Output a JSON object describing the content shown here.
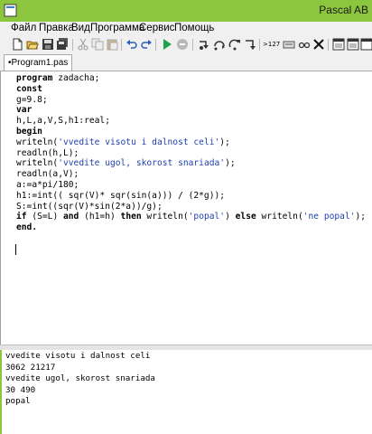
{
  "window": {
    "title": "Pascal AB"
  },
  "menu": [
    "Файл",
    "Правка",
    "Вид",
    "Программа",
    "Сервис",
    "Помощь"
  ],
  "toolbar": {
    "zoom_label": ">127"
  },
  "tabs": [
    {
      "label": "•Program1.pas"
    }
  ],
  "editor": {
    "lines": [
      [
        {
          "t": "program",
          "c": "kw"
        },
        {
          "t": " zadacha;",
          "c": ""
        }
      ],
      [
        {
          "t": "const",
          "c": "kw"
        }
      ],
      [
        {
          "t": "g=9.8;",
          "c": ""
        }
      ],
      [
        {
          "t": "var",
          "c": "kw"
        }
      ],
      [
        {
          "t": "h,L,a,V,S,h1:real;",
          "c": ""
        }
      ],
      [
        {
          "t": "begin",
          "c": "kw"
        }
      ],
      [
        {
          "t": "writeln(",
          "c": ""
        },
        {
          "t": "'vvedite visotu i dalnost celi'",
          "c": "str"
        },
        {
          "t": ");",
          "c": ""
        }
      ],
      [
        {
          "t": "readln(h,L);",
          "c": ""
        }
      ],
      [
        {
          "t": "writeln(",
          "c": ""
        },
        {
          "t": "'vvedite ugol, skorost snariada'",
          "c": "str"
        },
        {
          "t": ");",
          "c": ""
        }
      ],
      [
        {
          "t": "readln(a,V);",
          "c": ""
        }
      ],
      [
        {
          "t": "a:=a*pi/180;",
          "c": ""
        }
      ],
      [
        {
          "t": "h1:=int(( sqr(V)* sqr(sin(a))) / (2*g));",
          "c": ""
        }
      ],
      [
        {
          "t": "S:=int((sqr(V)*sin(2*a))/g);",
          "c": ""
        }
      ],
      [
        {
          "t": "if",
          "c": "kw"
        },
        {
          "t": " (S=L) ",
          "c": ""
        },
        {
          "t": "and",
          "c": "kw"
        },
        {
          "t": " (h1=h) ",
          "c": ""
        },
        {
          "t": "then",
          "c": "kw"
        },
        {
          "t": " writeln(",
          "c": ""
        },
        {
          "t": "'popal'",
          "c": "str"
        },
        {
          "t": ") ",
          "c": ""
        },
        {
          "t": "else",
          "c": "kw"
        },
        {
          "t": " writeln(",
          "c": ""
        },
        {
          "t": "'ne popal'",
          "c": "str"
        },
        {
          "t": ");",
          "c": ""
        }
      ],
      [
        {
          "t": "end.",
          "c": "kw"
        }
      ]
    ]
  },
  "output": {
    "lines": [
      "vvedite visotu i dalnost celi",
      "3062 21217",
      "vvedite ugol, skorost snariada",
      "30 490",
      "popal"
    ]
  },
  "colors": {
    "titlebar": "#8cc63f",
    "string": "#1f3fb0"
  },
  "icons": [
    "new-file-icon",
    "open-folder-icon",
    "save-icon",
    "save-all-icon",
    "cut-icon",
    "copy-icon",
    "paste-icon",
    "undo-icon",
    "redo-icon",
    "run-icon",
    "stop-icon",
    "step-into-icon",
    "step-over-icon",
    "step-out-icon",
    "run-to-cursor-icon",
    "watch-icon",
    "eye-icon",
    "glasses-icon",
    "close-icon",
    "window-icon",
    "window2-icon",
    "window3-icon",
    "window4-icon"
  ]
}
